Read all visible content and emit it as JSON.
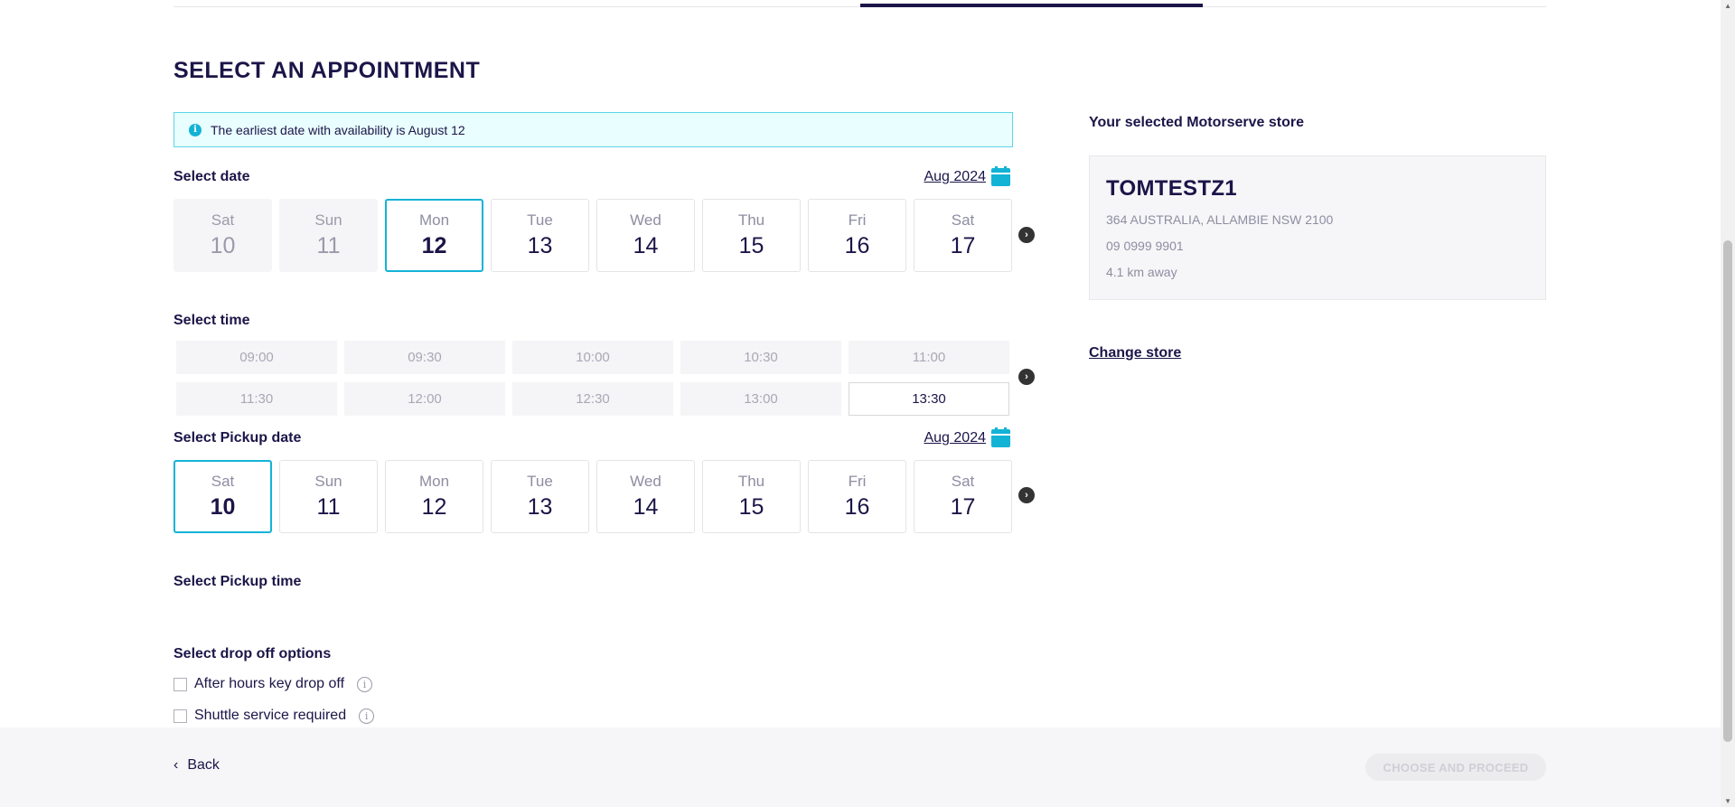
{
  "page_title": "SELECT AN APPOINTMENT",
  "info_banner": {
    "icon": "info-icon",
    "text": "The earliest date with availability is August 12"
  },
  "select_date": {
    "label": "Select date",
    "month": "Aug 2024",
    "days": [
      {
        "dow": "Sat",
        "day": "10",
        "state": "disabled"
      },
      {
        "dow": "Sun",
        "day": "11",
        "state": "disabled"
      },
      {
        "dow": "Mon",
        "day": "12",
        "state": "selected"
      },
      {
        "dow": "Tue",
        "day": "13",
        "state": "available"
      },
      {
        "dow": "Wed",
        "day": "14",
        "state": "available"
      },
      {
        "dow": "Thu",
        "day": "15",
        "state": "available"
      },
      {
        "dow": "Fri",
        "day": "16",
        "state": "available"
      },
      {
        "dow": "Sat",
        "day": "17",
        "state": "available"
      }
    ]
  },
  "select_time": {
    "label": "Select time",
    "slots": [
      {
        "time": "09:00",
        "state": "unavailable"
      },
      {
        "time": "09:30",
        "state": "unavailable"
      },
      {
        "time": "10:00",
        "state": "unavailable"
      },
      {
        "time": "10:30",
        "state": "unavailable"
      },
      {
        "time": "11:00",
        "state": "unavailable"
      },
      {
        "time": "11:30",
        "state": "unavailable"
      },
      {
        "time": "12:00",
        "state": "unavailable"
      },
      {
        "time": "12:30",
        "state": "unavailable"
      },
      {
        "time": "13:00",
        "state": "unavailable"
      },
      {
        "time": "13:30",
        "state": "available"
      }
    ]
  },
  "select_pickup_date": {
    "label": "Select Pickup date",
    "month": "Aug 2024",
    "days": [
      {
        "dow": "Sat",
        "day": "10",
        "state": "selected"
      },
      {
        "dow": "Sun",
        "day": "11",
        "state": "available"
      },
      {
        "dow": "Mon",
        "day": "12",
        "state": "available"
      },
      {
        "dow": "Tue",
        "day": "13",
        "state": "available"
      },
      {
        "dow": "Wed",
        "day": "14",
        "state": "available"
      },
      {
        "dow": "Thu",
        "day": "15",
        "state": "available"
      },
      {
        "dow": "Fri",
        "day": "16",
        "state": "available"
      },
      {
        "dow": "Sat",
        "day": "17",
        "state": "available"
      }
    ]
  },
  "select_pickup_time": {
    "label": "Select Pickup time"
  },
  "drop_off": {
    "label": "Select drop off options",
    "options": [
      {
        "label": "After hours key drop off",
        "checked": false
      },
      {
        "label": "Shuttle service required",
        "checked": false
      }
    ]
  },
  "store": {
    "heading": "Your selected Motorserve store",
    "name": "TOMTESTZ1",
    "address": "364 AUSTRALIA, ALLAMBIE NSW 2100",
    "phone": "09 0999 9901",
    "distance": "4.1 km away",
    "change_label": "Change store"
  },
  "footer": {
    "back_label": "Back",
    "proceed_label": "CHOOSE AND PROCEED"
  },
  "colors": {
    "brand_navy": "#1b1548",
    "accent_cyan": "#13b3d6",
    "banner_bg": "#e9fefe"
  }
}
